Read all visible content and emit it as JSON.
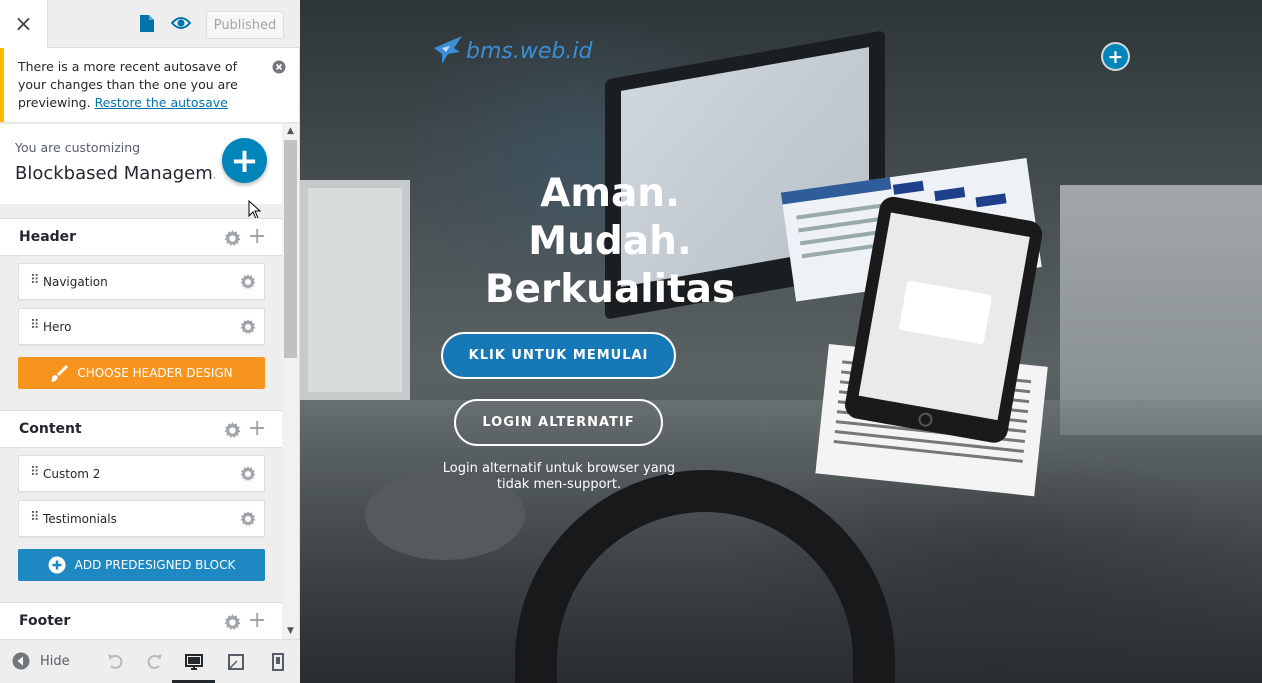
{
  "topbar": {
    "close_label": "×",
    "published_label": "Published"
  },
  "notice": {
    "text": "There is a more recent autosave of your changes than the one you are previewing.",
    "link": "Restore the autosave"
  },
  "info": {
    "you_are_customizing": "You are customizing",
    "site_name": "Blockbased Managem..."
  },
  "sections": {
    "header": {
      "title": "Header",
      "items": [
        {
          "label": "Navigation"
        },
        {
          "label": "Hero"
        }
      ],
      "button": "CHOOSE HEADER DESIGN"
    },
    "content": {
      "title": "Content",
      "items": [
        {
          "label": "Custom 2"
        },
        {
          "label": "Testimonials"
        }
      ],
      "button": "ADD PREDESIGNED BLOCK"
    },
    "footer": {
      "title": "Footer"
    }
  },
  "footer_bar": {
    "hide_label": "Hide"
  },
  "preview": {
    "logo_text": "bms.web.id",
    "hero_line1": "Aman.",
    "hero_line2": "Mudah.",
    "hero_line3": "Berkualitas",
    "cta_primary": "KLIK UNTUK MEMULAI",
    "cta_secondary": "LOGIN ALTERNATIF",
    "cta_note": "Login alternatif untuk browser yang tidak men-support."
  },
  "colors": {
    "accent_blue": "#0085ba",
    "orange_button": "#f7941d",
    "blue_button": "#1e88c3",
    "notice_border": "#ffb900"
  }
}
